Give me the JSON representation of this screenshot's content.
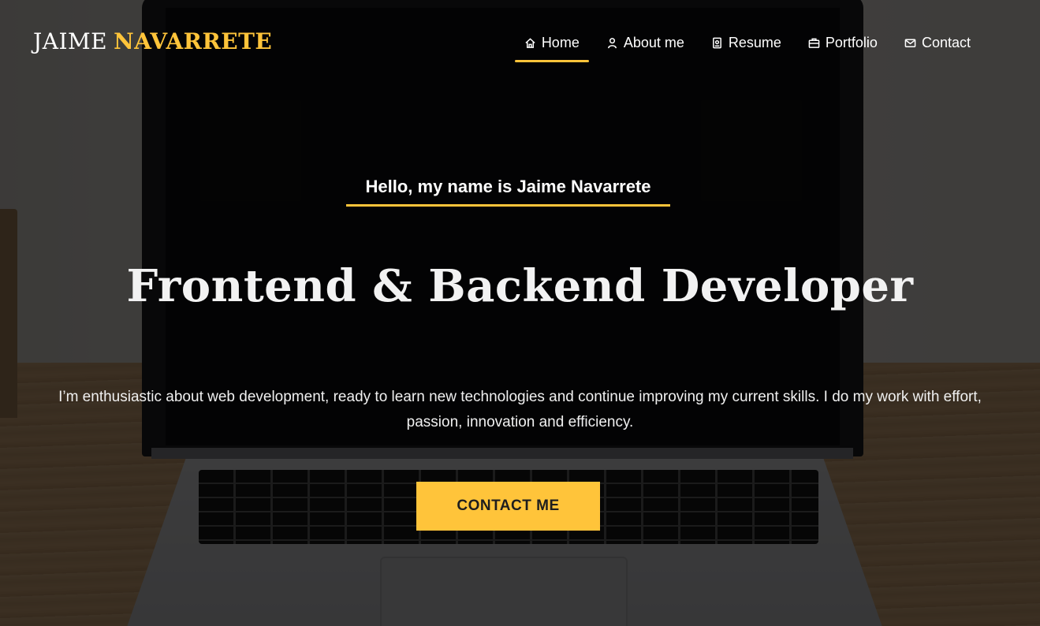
{
  "header": {
    "logo_first": "JAIME",
    "logo_last": "NAVARRETE",
    "nav": [
      {
        "label": "Home",
        "icon": "home-icon",
        "active": true
      },
      {
        "label": "About me",
        "icon": "user-icon",
        "active": false
      },
      {
        "label": "Resume",
        "icon": "id-card-icon",
        "active": false
      },
      {
        "label": "Portfolio",
        "icon": "briefcase-icon",
        "active": false
      },
      {
        "label": "Contact",
        "icon": "envelope-icon",
        "active": false
      }
    ]
  },
  "hero": {
    "greeting": "Hello, my name is Jaime Navarrete",
    "headline": "Frontend & Backend Developer",
    "intro": "I’m enthusiastic about web development, ready to learn new technologies and continue improving my current skills. I do my work with effort, passion, innovation and efficiency.",
    "cta_label": "CONTACT ME"
  },
  "colors": {
    "accent": "#ffc43a",
    "text": "#ffffff"
  }
}
